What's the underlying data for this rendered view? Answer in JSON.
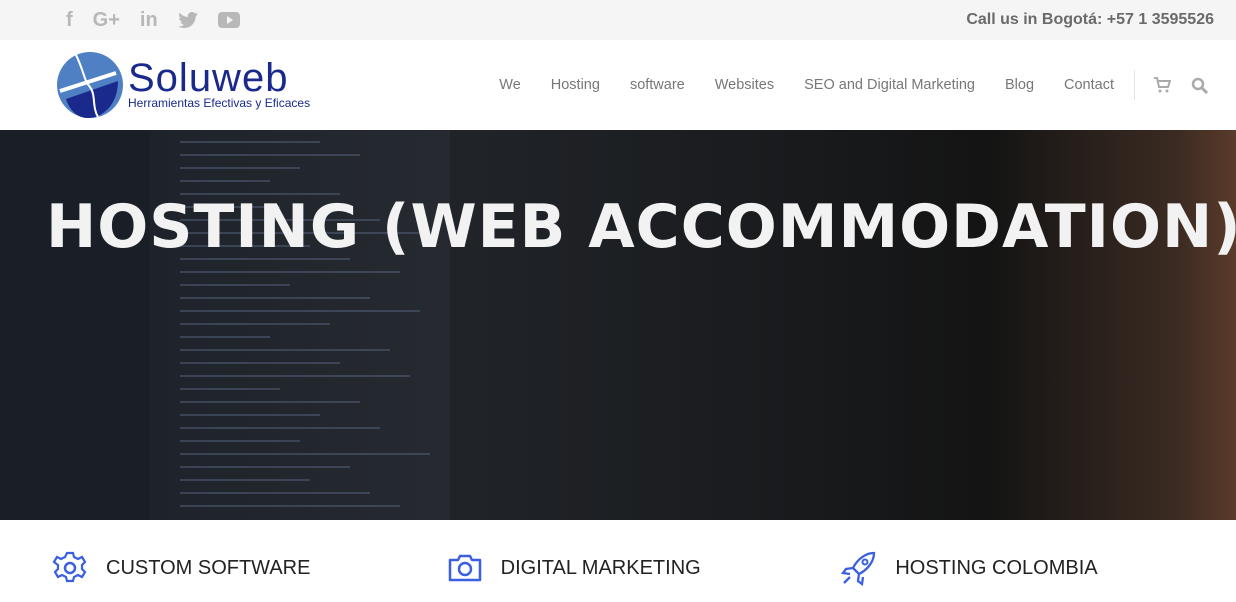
{
  "topbar": {
    "social": [
      "facebook-icon",
      "google-plus-icon",
      "linkedin-icon",
      "twitter-icon",
      "youtube-icon"
    ],
    "call": "Call us in Bogotá: +57 1 3595526"
  },
  "header": {
    "logo": {
      "brand": "Soluweb",
      "tagline": "Herramientas Efectivas y Eficaces"
    },
    "nav": [
      "We",
      "Hosting",
      "software",
      "Websites",
      "SEO and Digital Marketing",
      "Blog",
      "Contact"
    ]
  },
  "hero": {
    "title": "HOSTING (WEB ACCOMMODATION)"
  },
  "features": [
    {
      "icon": "gear-icon",
      "label": "CUSTOM SOFTWARE"
    },
    {
      "icon": "camera-icon",
      "label": "DIGITAL MARKETING"
    },
    {
      "icon": "rocket-icon",
      "label": "HOSTING COLOMBIA"
    }
  ],
  "colors": {
    "accent": "#3a5fe0",
    "brand": "#1a2a8c"
  }
}
